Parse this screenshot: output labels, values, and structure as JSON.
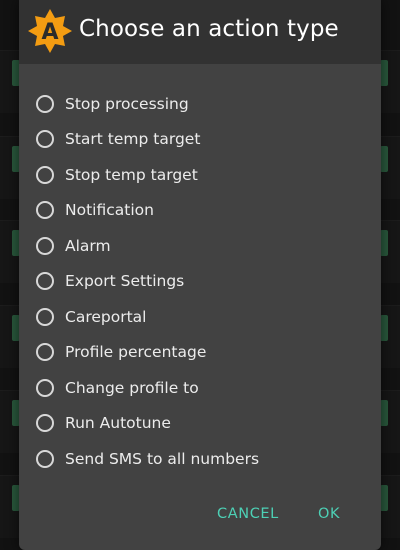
{
  "dialog": {
    "title": "Choose an action type",
    "app_icon_letter": "A",
    "app_icon_color": "#f39c12",
    "options": [
      {
        "label": "Stop processing",
        "selected": false
      },
      {
        "label": "Start temp target",
        "selected": false
      },
      {
        "label": "Stop temp target",
        "selected": false
      },
      {
        "label": "Notification",
        "selected": false
      },
      {
        "label": "Alarm",
        "selected": false
      },
      {
        "label": "Export Settings",
        "selected": false
      },
      {
        "label": "Careportal",
        "selected": false
      },
      {
        "label": "Profile percentage",
        "selected": false
      },
      {
        "label": "Change profile to",
        "selected": false
      },
      {
        "label": "Run Autotune",
        "selected": false
      },
      {
        "label": "Send SMS to all numbers",
        "selected": false
      }
    ],
    "buttons": {
      "cancel_label": "CANCEL",
      "ok_label": "OK"
    }
  },
  "colors": {
    "dialog_background": "#424242",
    "header_background": "#323232",
    "button_text": "#4dd0b5"
  }
}
